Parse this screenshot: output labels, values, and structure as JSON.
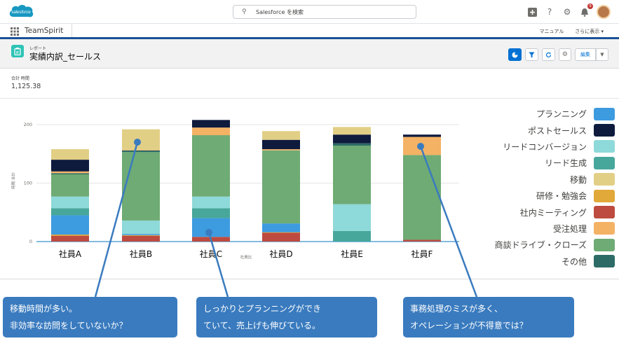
{
  "topbar": {
    "logo_text": "salesforce",
    "search_placeholder": "Salesforce を検索",
    "notification_count": "9"
  },
  "nav": {
    "app_name": "TeamSpirit",
    "manual": "マニュアル",
    "more": "さらに表示 ▾"
  },
  "report": {
    "type_label": "レポート",
    "title": "実績内訳_セールス",
    "edit_label": "編集",
    "total_label": "合計 時間",
    "total_value": "1,125.38"
  },
  "colors": {
    "planning": "#3d9be0",
    "post_sales": "#0e1b3d",
    "lead_conversion": "#8ed9d9",
    "lead_generation": "#47a79b",
    "travel": "#e2cf86",
    "training": "#e1a83a",
    "internal_meeting": "#bd4b3f",
    "order_processing": "#f4b265",
    "negotiation": "#6fab74",
    "other": "#2d6b66",
    "callout": "#3a7bbf"
  },
  "chart_data": {
    "type": "bar",
    "stacked": true,
    "categories": [
      "社員A",
      "社員B",
      "社員C",
      "社員D",
      "社員E",
      "社員F"
    ],
    "xlabel": "社員比",
    "ylabel": "時間 合計",
    "yticks": [
      "0",
      "100",
      "200"
    ],
    "ylim": [
      0,
      220
    ],
    "grid": true,
    "legend_position": "right",
    "series": [
      {
        "name": "社内ミーティング",
        "color": "#bd4b3f",
        "values": [
          10,
          10,
          8,
          15,
          0,
          3
        ]
      },
      {
        "name": "研修・勉強会",
        "color": "#e1a83a",
        "values": [
          2,
          1,
          0,
          1,
          0,
          0
        ]
      },
      {
        "name": "プランニング",
        "color": "#3d9be0",
        "values": [
          33,
          2,
          32,
          15,
          0,
          0
        ]
      },
      {
        "name": "リード生成",
        "color": "#47a79b",
        "values": [
          12,
          0,
          17,
          0,
          18,
          0
        ]
      },
      {
        "name": "リードコンバージョン",
        "color": "#8ed9d9",
        "values": [
          20,
          23,
          20,
          0,
          46,
          0
        ]
      },
      {
        "name": "商談ドライブ・クローズ",
        "color": "#6fab74",
        "values": [
          38,
          117,
          105,
          125,
          100,
          145
        ]
      },
      {
        "name": "その他",
        "color": "#2d6b66",
        "values": [
          2,
          3,
          0,
          0,
          4,
          0
        ]
      },
      {
        "name": "受注処理",
        "color": "#f4b265",
        "values": [
          3,
          1,
          13,
          2,
          0,
          31
        ]
      },
      {
        "name": "ポストセールス",
        "color": "#0e1b3d",
        "values": [
          20,
          0,
          13,
          16,
          15,
          4
        ]
      },
      {
        "name": "移動",
        "color": "#e2cf86",
        "values": [
          18,
          35,
          0,
          15,
          13,
          0
        ]
      }
    ]
  },
  "legend": [
    {
      "label": "プランニング",
      "color": "#3d9be0"
    },
    {
      "label": "ポストセールス",
      "color": "#0e1b3d"
    },
    {
      "label": "リードコンバージョン",
      "color": "#8ed9d9"
    },
    {
      "label": "リード生成",
      "color": "#47a79b"
    },
    {
      "label": "移動",
      "color": "#e2cf86"
    },
    {
      "label": "研修・勉強会",
      "color": "#e1a83a"
    },
    {
      "label": "社内ミーティング",
      "color": "#bd4b3f"
    },
    {
      "label": "受注処理",
      "color": "#f4b265"
    },
    {
      "label": "商談ドライブ・クローズ",
      "color": "#6fab74"
    },
    {
      "label": "その他",
      "color": "#2d6b66"
    }
  ],
  "callouts": [
    {
      "line1": "移動時間が多い。",
      "line2": "非効率な訪問をしていないか？"
    },
    {
      "line1": "しっかりとプランニングができ",
      "line2": "ていて、売上げも伸びている。"
    },
    {
      "line1": "事務処理のミスが多く、",
      "line2": "オペレーションが不得意では？"
    }
  ]
}
